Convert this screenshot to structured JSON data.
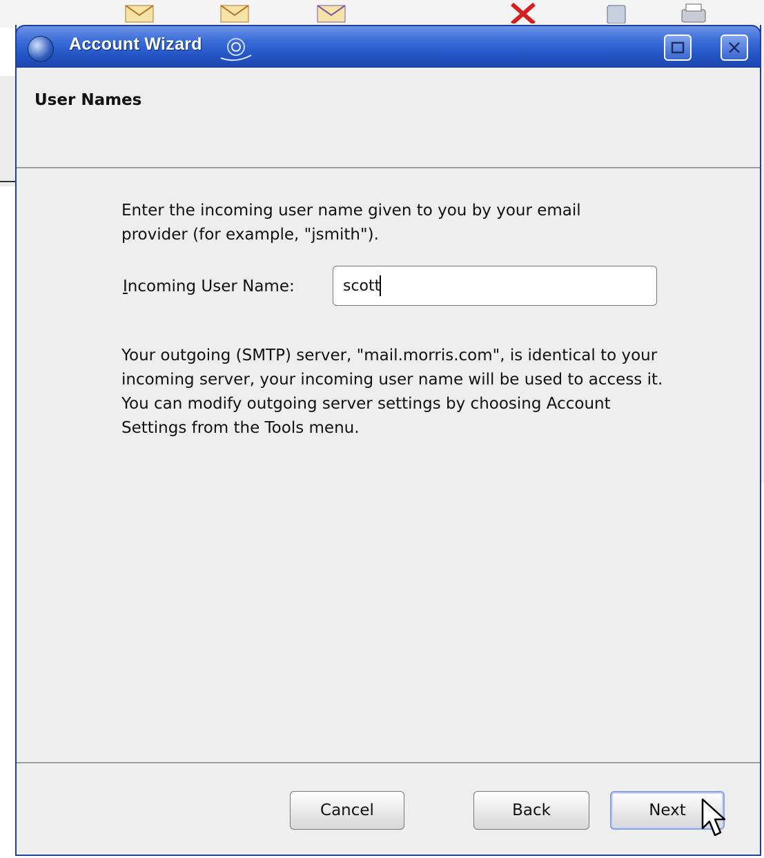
{
  "window": {
    "title": "Account Wizard",
    "page_heading": "User Names"
  },
  "content": {
    "intro_text": "Enter the incoming user name given to you by your email provider (for example, \"jsmith\").",
    "username_label_mnemonic": "I",
    "username_label_rest": "ncoming User Name:",
    "username_value": "scott",
    "smtp_info_text": "Your outgoing (SMTP) server, \"mail.morris.com\", is identical to your incoming server, your incoming user name will be used to access it. You can modify outgoing server settings by choosing Account Settings from the Tools menu."
  },
  "buttons": {
    "cancel": "Cancel",
    "back": "Back",
    "next": "Next"
  },
  "colors": {
    "titlebar": "#2456c8",
    "dialog_bg": "#eeeeee",
    "frame": "#1e3f9a"
  },
  "icons": {
    "app": "thunderbird-globe-icon",
    "title_decoration": "swirl-icon",
    "maximize": "maximize-icon",
    "close": "close-icon",
    "cursor": "mouse-pointer-icon"
  }
}
